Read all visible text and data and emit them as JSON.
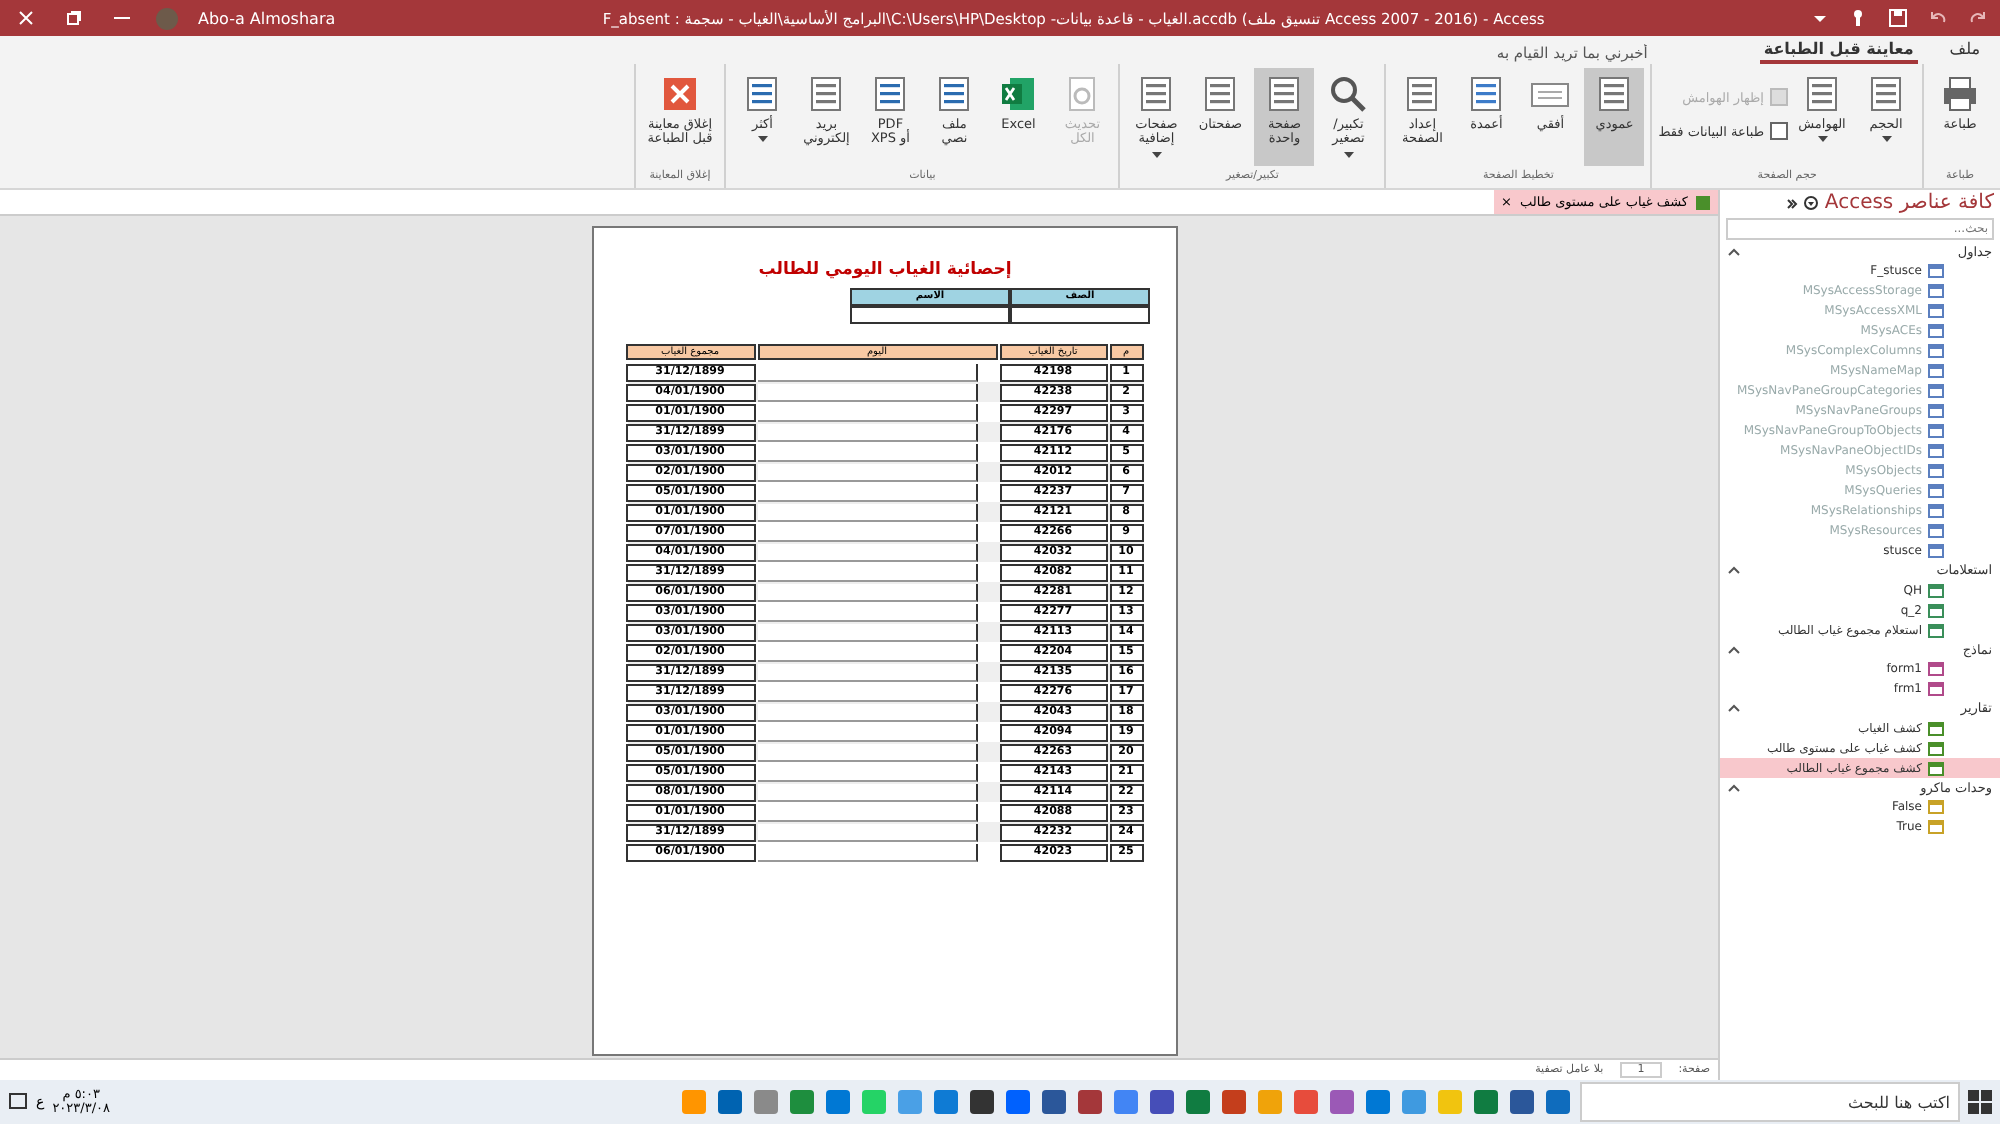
{
  "window": {
    "title": "Access - (Access 2007 - 2016 تنسيق ملف) accdb.الغياب - قاعدة بيانات- C:\\Users\\HP\\Desktop\\البرامج الأساسية\\الغياب - سجمة : F_absent",
    "user": "Abo-a Almoshara"
  },
  "tabs": [
    {
      "label": "ملف",
      "selected": false
    },
    {
      "label": "معاينة قبل الطباعة",
      "selected": true
    }
  ],
  "tell_me": {
    "placeholder": "أخبرني بما تريد القيام به"
  },
  "ribbon": [
    {
      "label": "طباعة",
      "items": [
        {
          "kind": "button",
          "label": "طباعة",
          "menu": false,
          "selected": false,
          "disabled": false
        }
      ]
    },
    {
      "label": "حجم الصفحة",
      "items": [
        {
          "kind": "button",
          "label": "الحجم",
          "menu": true,
          "selected": false,
          "disabled": false
        },
        {
          "kind": "button",
          "label": "الهوامش",
          "menu": true,
          "selected": false,
          "disabled": false
        },
        {
          "kind": "checks",
          "checks": [
            {
              "label": "إظهار الهوامش",
              "checked": false,
              "disabled": true
            },
            {
              "label": "طباعة البيانات فقط",
              "checked": false,
              "disabled": false
            }
          ]
        }
      ]
    },
    {
      "label": "تخطيط الصفحة",
      "items": [
        {
          "kind": "button",
          "label": "عمودي",
          "menu": false,
          "selected": true,
          "disabled": false
        },
        {
          "kind": "button",
          "label": "أفقي",
          "menu": false,
          "selected": false,
          "disabled": false
        },
        {
          "kind": "button",
          "label": "أعمدة",
          "menu": false,
          "selected": false,
          "disabled": false
        },
        {
          "kind": "button",
          "label": "إعداد\nالصفحة",
          "menu": false,
          "selected": false,
          "disabled": false
        }
      ]
    },
    {
      "label": "تكبير/تصغير",
      "items": [
        {
          "kind": "button",
          "label": "تكبير/\nتصغير",
          "menu": true,
          "selected": false,
          "disabled": false
        },
        {
          "kind": "button",
          "label": "صفحة\nواحدة",
          "menu": false,
          "selected": true,
          "disabled": false
        },
        {
          "kind": "button",
          "label": "صفحتان",
          "menu": false,
          "selected": false,
          "disabled": false
        },
        {
          "kind": "button",
          "label": "صفحات\nإضافية",
          "menu": true,
          "selected": false,
          "disabled": false
        }
      ]
    },
    {
      "label": "بيانات",
      "items": [
        {
          "kind": "button",
          "label": "تحديث\nالكل",
          "menu": false,
          "selected": false,
          "disabled": true
        },
        {
          "kind": "button",
          "label": "Excel",
          "menu": false,
          "selected": false,
          "disabled": false
        },
        {
          "kind": "button",
          "label": "ملف\nنصي",
          "menu": false,
          "selected": false,
          "disabled": false
        },
        {
          "kind": "button",
          "label": "PDF\nأو XPS",
          "menu": false,
          "selected": false,
          "disabled": false
        },
        {
          "kind": "button",
          "label": "بريد\nإلكتروني",
          "menu": false,
          "selected": false,
          "disabled": false
        },
        {
          "kind": "button",
          "label": "أكثر",
          "menu": true,
          "selected": false,
          "disabled": false
        }
      ]
    },
    {
      "label": "إغلاق المعاينة",
      "items": [
        {
          "kind": "button",
          "label": "إغلاق معاينة\nقبل الطباعة",
          "menu": false,
          "selected": false,
          "disabled": false
        }
      ]
    }
  ],
  "document_tab": {
    "label": "كشف غياب على مستوى طالب",
    "close": "×"
  },
  "report": {
    "title": "إحصائية الغياب اليومي للطالب",
    "header_labels": [
      "الصف",
      "الاسم"
    ],
    "columns": [
      "م",
      "تاريخ الغياب",
      "اليوم",
      "مجموع الغياب"
    ],
    "rows": [
      [
        "1",
        "42198",
        "31/12/1899"
      ],
      [
        "2",
        "42238",
        "04/01/1900"
      ],
      [
        "3",
        "42297",
        "01/01/1900"
      ],
      [
        "4",
        "42176",
        "31/12/1899"
      ],
      [
        "5",
        "42112",
        "03/01/1900"
      ],
      [
        "6",
        "42012",
        "02/01/1900"
      ],
      [
        "7",
        "42237",
        "05/01/1900"
      ],
      [
        "8",
        "42121",
        "01/01/1900"
      ],
      [
        "9",
        "42266",
        "07/01/1900"
      ],
      [
        "10",
        "42032",
        "04/01/1900"
      ],
      [
        "11",
        "42082",
        "31/12/1899"
      ],
      [
        "12",
        "42281",
        "06/01/1900"
      ],
      [
        "13",
        "42277",
        "03/01/1900"
      ],
      [
        "14",
        "42113",
        "03/01/1900"
      ],
      [
        "15",
        "42204",
        "02/01/1900"
      ],
      [
        "16",
        "42135",
        "31/12/1899"
      ],
      [
        "17",
        "42276",
        "31/12/1899"
      ],
      [
        "18",
        "42043",
        "03/01/1900"
      ],
      [
        "19",
        "42094",
        "01/01/1900"
      ],
      [
        "20",
        "42263",
        "05/01/1900"
      ],
      [
        "21",
        "42143",
        "05/01/1900"
      ],
      [
        "22",
        "42114",
        "08/01/1900"
      ],
      [
        "23",
        "42088",
        "01/01/1900"
      ],
      [
        "24",
        "42232",
        "31/12/1899"
      ],
      [
        "25",
        "42023",
        "06/01/1900"
      ]
    ]
  },
  "record_nav": {
    "label": "صفحة:",
    "value": "1",
    "filter": "بلا عامل تصفية"
  },
  "nav_pane": {
    "title": "كافة عناصر Access",
    "search": {
      "placeholder": "بحث..."
    },
    "groups": [
      {
        "label": "جداول",
        "kind": "table",
        "items": [
          {
            "label": "F_stusce",
            "dimmed": false,
            "selected": false
          },
          {
            "label": "MSysAccessStorage",
            "dimmed": true,
            "selected": false
          },
          {
            "label": "MSysAccessXML",
            "dimmed": true,
            "selected": false
          },
          {
            "label": "MSysACEs",
            "dimmed": true,
            "selected": false
          },
          {
            "label": "MSysComplexColumns",
            "dimmed": true,
            "selected": false
          },
          {
            "label": "MSysNameMap",
            "dimmed": true,
            "selected": false
          },
          {
            "label": "MSysNavPaneGroupCategories",
            "dimmed": true,
            "selected": false
          },
          {
            "label": "MSysNavPaneGroups",
            "dimmed": true,
            "selected": false
          },
          {
            "label": "MSysNavPaneGroupToObjects",
            "dimmed": true,
            "selected": false
          },
          {
            "label": "MSysNavPaneObjectIDs",
            "dimmed": true,
            "selected": false
          },
          {
            "label": "MSysObjects",
            "dimmed": true,
            "selected": false
          },
          {
            "label": "MSysQueries",
            "dimmed": true,
            "selected": false
          },
          {
            "label": "MSysRelationships",
            "dimmed": true,
            "selected": false
          },
          {
            "label": "MSysResources",
            "dimmed": true,
            "selected": false
          },
          {
            "label": "stusce",
            "dimmed": false,
            "selected": false
          }
        ]
      },
      {
        "label": "استعلامات",
        "kind": "query",
        "items": [
          {
            "label": "QH",
            "dimmed": false,
            "selected": false
          },
          {
            "label": "q_2",
            "dimmed": false,
            "selected": false
          },
          {
            "label": "استعلام مجموع غياب الطالب",
            "dimmed": false,
            "selected": false
          }
        ]
      },
      {
        "label": "نماذج",
        "kind": "form",
        "items": [
          {
            "label": "form1",
            "dimmed": false,
            "selected": false
          },
          {
            "label": "frm1",
            "dimmed": false,
            "selected": false
          }
        ]
      },
      {
        "label": "تقارير",
        "kind": "report",
        "items": [
          {
            "label": "كشف الغياب",
            "dimmed": false,
            "selected": false
          },
          {
            "label": "كشف غياب على مستوى طالب",
            "dimmed": false,
            "selected": false
          },
          {
            "label": "كشف مجموع غياب الطالب",
            "dimmed": false,
            "selected": true
          }
        ]
      },
      {
        "label": "وحدات ماكرو",
        "kind": "macro",
        "items": [
          {
            "label": "False",
            "dimmed": false,
            "selected": false
          },
          {
            "label": "True",
            "dimmed": false,
            "selected": false
          }
        ]
      }
    ]
  },
  "taskbar": {
    "search": {
      "placeholder": "اكتب هنا للبحث"
    },
    "language": "ع",
    "time": "٥:٠٣ م",
    "date": "٢٠٢٣/٣/٠٨"
  }
}
